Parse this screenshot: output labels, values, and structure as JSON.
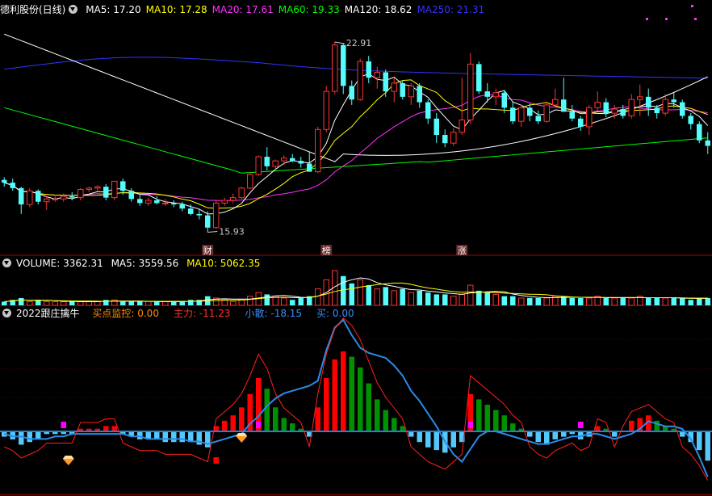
{
  "price_panel": {
    "title": "德利股份(日线)",
    "ma": [
      {
        "label": "MA5: 17.20",
        "color": "#ffffff"
      },
      {
        "label": "MA10: 17.28",
        "color": "#ffff00"
      },
      {
        "label": "MA20: 17.61",
        "color": "#ff33ff"
      },
      {
        "label": "MA60: 19.33",
        "color": "#00ff00"
      },
      {
        "label": "MA120: 18.62",
        "color": "#ffffff"
      },
      {
        "label": "MA250: 21.31",
        "color": "#3333ff"
      }
    ],
    "high_label": "22.91",
    "low_label": "15.93",
    "markers": [
      {
        "text": "财",
        "index": 24
      },
      {
        "text": "榜",
        "index": 38
      },
      {
        "text": "涨",
        "index": 54
      }
    ],
    "colors": {
      "up": "#ff3232",
      "down": "#54fcfc",
      "bg": "#000000"
    }
  },
  "volume_panel": {
    "title": "VOLUME: 3362.31",
    "ma5": "MA5: 3559.56",
    "ma10": "MA10: 5062.35"
  },
  "indicator_panel": {
    "title": "2022跟庄擒牛",
    "fields": [
      {
        "label": "买点监控: 0.00",
        "color": "#ff8c00"
      },
      {
        "label": "主力: -11.23",
        "color": "#ff3232"
      },
      {
        "label": "小散: -18.15",
        "color": "#3c8cff"
      },
      {
        "label": "买: 0.00",
        "color": "#3c8cff"
      }
    ]
  },
  "chart_data": {
    "type": "candlestick",
    "price_range": [
      15.5,
      23.8
    ],
    "candles": [
      [
        17.85,
        17.95,
        17.6,
        17.75
      ],
      [
        17.75,
        17.9,
        17.45,
        17.55
      ],
      [
        17.55,
        17.6,
        16.6,
        16.95
      ],
      [
        16.95,
        17.55,
        16.85,
        17.45
      ],
      [
        17.45,
        17.5,
        16.95,
        17.05
      ],
      [
        17.05,
        17.25,
        16.75,
        17.15
      ],
      [
        17.15,
        17.3,
        17.05,
        17.15
      ],
      [
        17.15,
        17.35,
        17.05,
        17.25
      ],
      [
        17.25,
        17.4,
        17.1,
        17.2
      ],
      [
        17.2,
        17.55,
        17.1,
        17.5
      ],
      [
        17.5,
        17.6,
        17.4,
        17.55
      ],
      [
        17.55,
        17.65,
        17.45,
        17.6
      ],
      [
        17.6,
        17.7,
        17.1,
        17.2
      ],
      [
        17.2,
        17.8,
        17.1,
        17.8
      ],
      [
        17.8,
        17.9,
        17.3,
        17.45
      ],
      [
        17.45,
        17.55,
        17.05,
        17.15
      ],
      [
        17.15,
        17.3,
        16.9,
        17.0
      ],
      [
        17.0,
        17.2,
        16.9,
        17.1
      ],
      [
        17.1,
        17.25,
        16.95,
        17.0
      ],
      [
        17.0,
        17.15,
        16.9,
        17.0
      ],
      [
        17.0,
        17.1,
        16.85,
        16.95
      ],
      [
        16.95,
        17.05,
        16.7,
        16.8
      ],
      [
        16.8,
        16.95,
        16.55,
        16.6
      ],
      [
        16.6,
        16.8,
        16.4,
        16.55
      ],
      [
        16.55,
        16.7,
        15.93,
        16.1
      ],
      [
        16.1,
        17.1,
        16.05,
        17.0
      ],
      [
        17.0,
        17.2,
        16.9,
        17.1
      ],
      [
        17.1,
        17.35,
        17.0,
        17.2
      ],
      [
        17.2,
        17.6,
        17.15,
        17.55
      ],
      [
        17.55,
        18.15,
        17.5,
        18.05
      ],
      [
        18.05,
        18.75,
        18.0,
        18.7
      ],
      [
        18.7,
        19.05,
        18.2,
        18.35
      ],
      [
        18.35,
        18.6,
        18.2,
        18.55
      ],
      [
        18.55,
        18.75,
        18.4,
        18.65
      ],
      [
        18.65,
        18.8,
        18.5,
        18.55
      ],
      [
        18.55,
        18.7,
        18.3,
        18.45
      ],
      [
        18.45,
        18.9,
        18.3,
        18.15
      ],
      [
        18.15,
        19.8,
        18.1,
        19.7
      ],
      [
        19.7,
        21.3,
        19.6,
        21.1
      ],
      [
        21.1,
        22.91,
        21.0,
        22.8
      ],
      [
        22.8,
        22.85,
        21.0,
        21.3
      ],
      [
        21.3,
        21.5,
        20.6,
        20.8
      ],
      [
        20.8,
        22.3,
        20.75,
        22.2
      ],
      [
        22.2,
        22.4,
        21.4,
        21.6
      ],
      [
        21.6,
        22.0,
        21.2,
        21.8
      ],
      [
        21.8,
        21.9,
        20.9,
        21.1
      ],
      [
        21.1,
        21.6,
        20.7,
        21.4
      ],
      [
        21.4,
        21.5,
        20.8,
        20.9
      ],
      [
        20.9,
        21.4,
        20.6,
        21.3
      ],
      [
        21.3,
        21.4,
        20.5,
        20.7
      ],
      [
        20.7,
        20.8,
        19.9,
        20.1
      ],
      [
        20.1,
        20.3,
        19.2,
        19.5
      ],
      [
        19.5,
        19.7,
        19.05,
        19.2
      ],
      [
        19.2,
        19.75,
        19.1,
        19.6
      ],
      [
        19.6,
        21.6,
        19.5,
        20.05
      ],
      [
        20.05,
        22.5,
        19.9,
        22.1
      ],
      [
        22.1,
        22.2,
        21.0,
        21.1
      ],
      [
        21.1,
        21.4,
        20.7,
        20.9
      ],
      [
        20.9,
        21.2,
        20.6,
        21.05
      ],
      [
        21.05,
        21.15,
        20.3,
        20.5
      ],
      [
        20.5,
        20.7,
        19.9,
        20.0
      ],
      [
        20.0,
        20.6,
        19.8,
        20.5
      ],
      [
        20.5,
        20.65,
        20.0,
        20.2
      ],
      [
        20.2,
        20.4,
        19.9,
        20.0
      ],
      [
        20.0,
        20.7,
        19.95,
        20.6
      ],
      [
        20.6,
        21.2,
        20.5,
        20.8
      ],
      [
        20.8,
        21.6,
        20.7,
        20.35
      ],
      [
        20.35,
        20.6,
        20.0,
        20.1
      ],
      [
        20.1,
        20.2,
        19.65,
        19.8
      ],
      [
        19.8,
        20.6,
        19.5,
        20.5
      ],
      [
        20.5,
        21.1,
        20.4,
        20.7
      ],
      [
        20.7,
        20.85,
        20.15,
        20.3
      ],
      [
        20.3,
        20.6,
        20.1,
        20.45
      ],
      [
        20.45,
        20.6,
        20.1,
        20.2
      ],
      [
        20.2,
        21.0,
        20.1,
        20.8
      ],
      [
        20.8,
        21.35,
        20.2,
        20.9
      ],
      [
        20.9,
        21.2,
        20.2,
        20.5
      ],
      [
        20.5,
        20.6,
        20.1,
        20.3
      ],
      [
        20.3,
        21.0,
        20.2,
        20.8
      ],
      [
        20.8,
        21.05,
        20.5,
        20.7
      ],
      [
        20.7,
        20.8,
        20.1,
        20.2
      ],
      [
        20.2,
        20.3,
        19.7,
        19.9
      ],
      [
        19.9,
        20.0,
        19.2,
        19.3
      ],
      [
        19.3,
        19.6,
        18.8,
        19.1
      ]
    ],
    "volume": [
      2,
      3,
      4,
      2,
      3,
      2,
      2,
      2,
      2,
      2,
      2,
      2,
      3,
      3,
      2,
      2,
      2,
      2,
      2,
      2,
      2,
      2,
      3,
      3,
      5,
      4,
      3,
      2,
      3,
      5,
      7,
      6,
      5,
      4,
      3,
      4,
      5,
      9,
      14,
      19,
      16,
      12,
      14,
      11,
      9,
      10,
      8,
      9,
      7,
      8,
      7,
      6,
      6,
      5,
      6,
      11,
      8,
      7,
      6,
      5,
      5,
      4,
      4,
      4,
      4,
      5,
      5,
      4,
      4,
      4,
      5,
      4,
      4,
      4,
      4,
      5,
      4,
      4,
      4,
      4,
      4,
      3,
      4,
      4
    ],
    "main_force": [
      -2,
      -3,
      -5,
      -4,
      -3,
      -1,
      -1,
      -1,
      -1,
      1,
      1,
      1,
      2,
      2,
      -1,
      -2,
      -3,
      -3,
      -3,
      -4,
      -4,
      -4,
      -4,
      -5,
      -6,
      2,
      4,
      6,
      9,
      14,
      20,
      16,
      9,
      5,
      3,
      1,
      -2,
      9,
      20,
      27,
      30,
      28,
      24,
      18,
      12,
      8,
      5,
      2,
      -2,
      -4,
      -6,
      -7,
      -8,
      -6,
      -4,
      14,
      12,
      10,
      8,
      6,
      3,
      1,
      -2,
      -4,
      -5,
      -3,
      -2,
      -1,
      -3,
      -2,
      2,
      1,
      -2,
      0,
      4,
      5,
      6,
      4,
      2,
      1,
      -2,
      -4,
      -7,
      -11
    ],
    "retail": [
      -1,
      -2,
      -2,
      -3,
      -3,
      -3,
      -2,
      -2,
      -1,
      -1,
      -1,
      -1,
      -1,
      -1,
      -1,
      -2,
      -2,
      -3,
      -3,
      -3,
      -3,
      -3,
      -4,
      -4,
      -5,
      -4,
      -3,
      -2,
      -1,
      3,
      6,
      10,
      13,
      15,
      16,
      17,
      18,
      20,
      32,
      41,
      44,
      38,
      33,
      31,
      30,
      29,
      26,
      22,
      16,
      12,
      7,
      2,
      -4,
      -9,
      -12,
      -7,
      -2,
      0,
      0,
      -1,
      -2,
      -3,
      -4,
      -5,
      -5,
      -4,
      -3,
      -2,
      -2,
      -1,
      -1,
      -2,
      -3,
      -2,
      -1,
      1,
      4,
      3,
      2,
      2,
      1,
      -3,
      -10,
      -18
    ],
    "buy_signals": [
      7,
      28
    ]
  }
}
